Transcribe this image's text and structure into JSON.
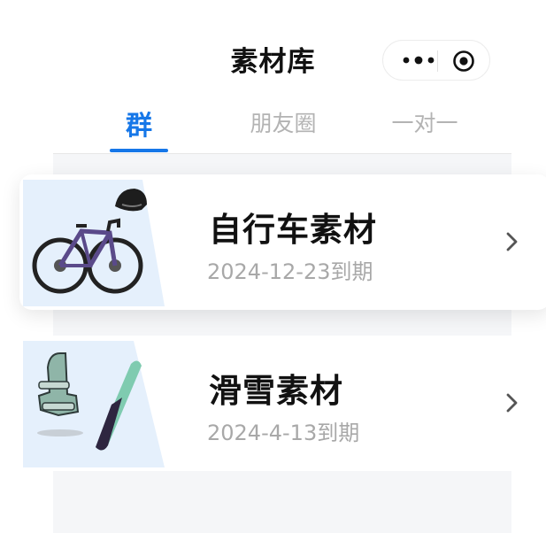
{
  "header": {
    "title": "素材库",
    "more_icon": "more-dots-icon",
    "close_icon": "target-circle-icon"
  },
  "tabs": [
    {
      "label": "群",
      "active": true
    },
    {
      "label": "朋友圈",
      "active": false
    },
    {
      "label": "一对一",
      "active": false
    }
  ],
  "cards": [
    {
      "title": "自行车素材",
      "date": "2024-12-23到期",
      "image": "bicycle-helmet-image",
      "arrow": "chevron-right-icon"
    },
    {
      "title": "滑雪素材",
      "date": "2024-4-13到期",
      "image": "snowboard-binding-image",
      "arrow": "chevron-right-icon"
    }
  ],
  "colors": {
    "accent": "#1677e8",
    "text_primary": "#111111",
    "text_secondary": "#a8a8a8",
    "tab_inactive": "#b3b3b3",
    "panel_bg": "#f5f6f8",
    "thumb_bg": "#e5f0fc"
  }
}
